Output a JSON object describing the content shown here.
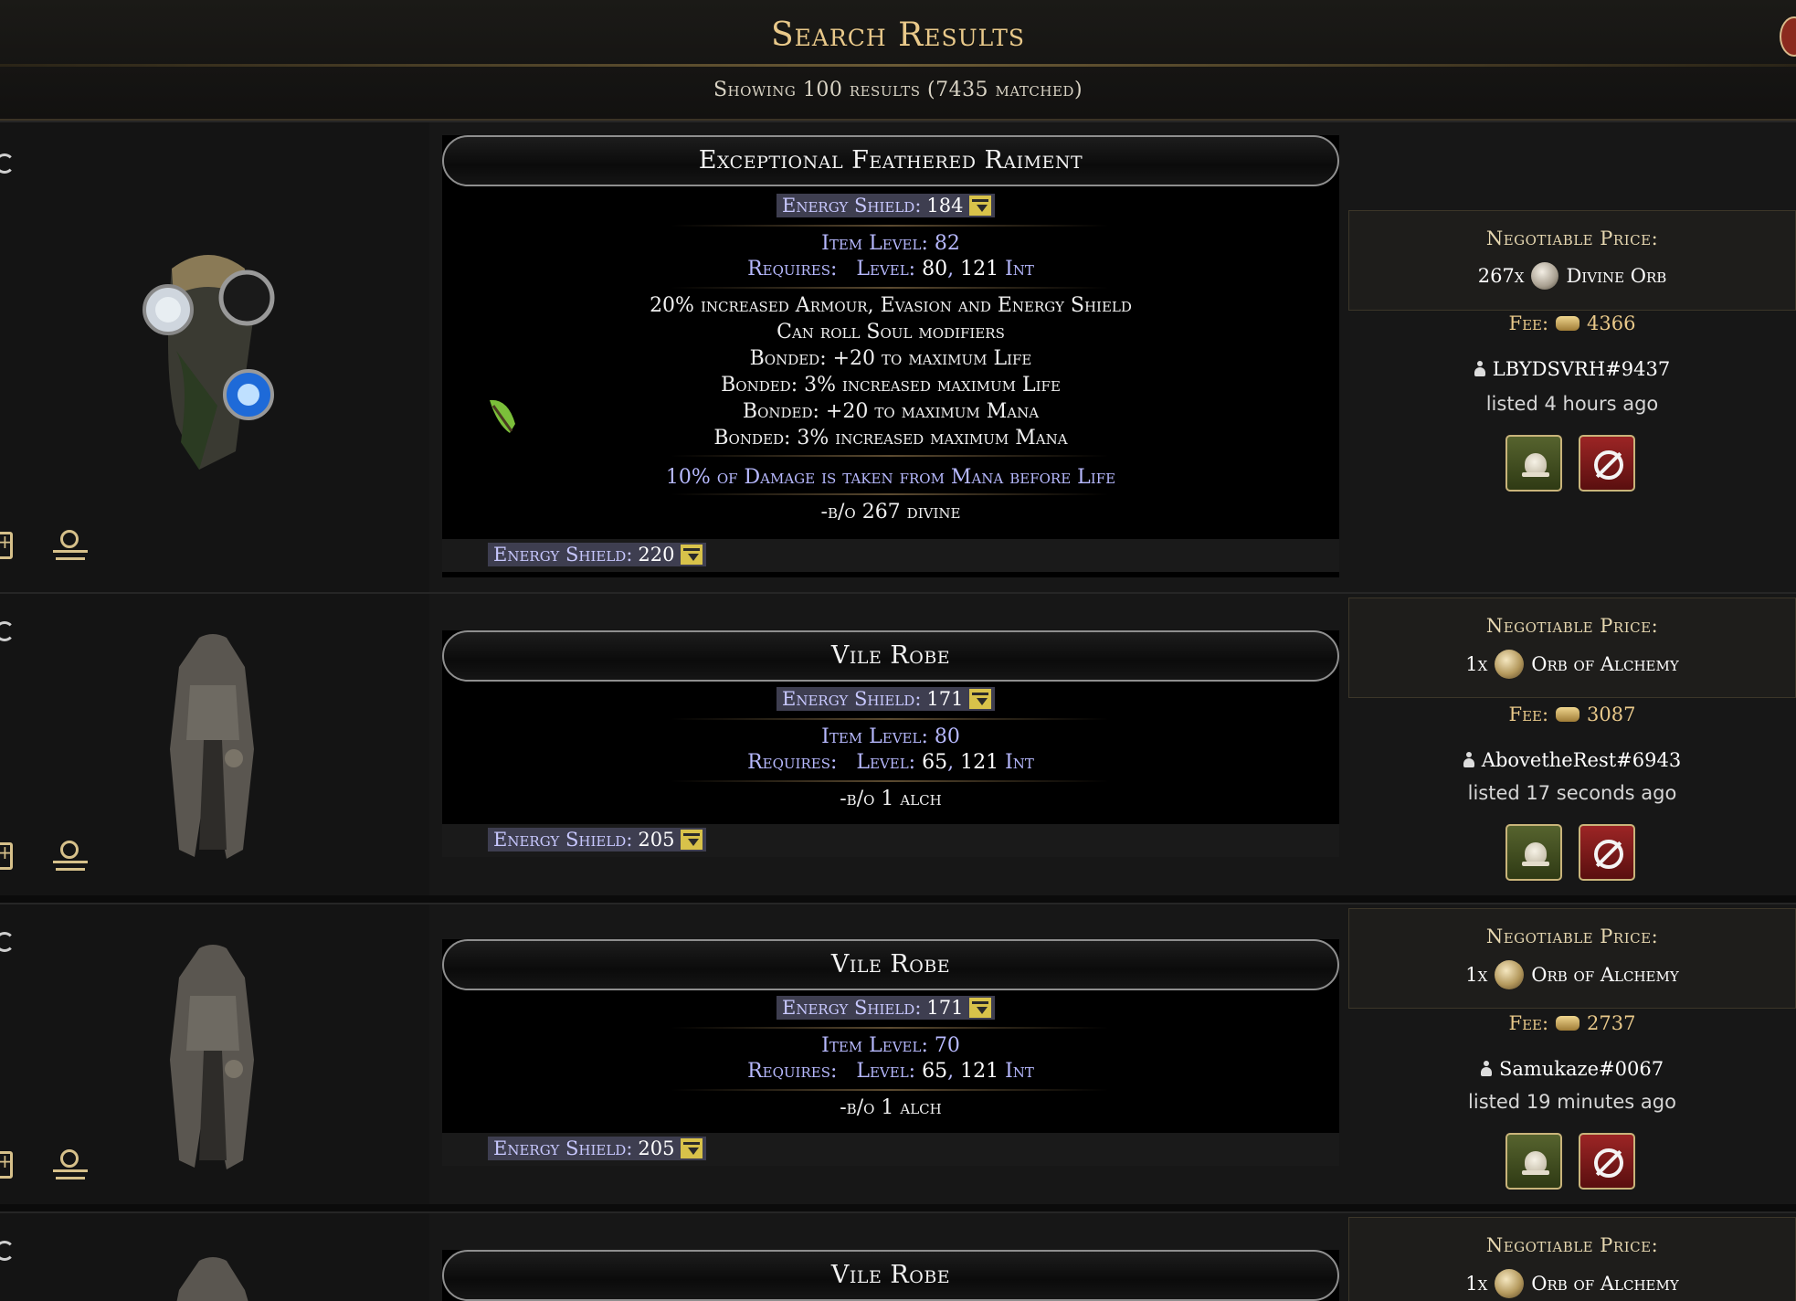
{
  "header": {
    "title": "Search Results",
    "subtitle": "Showing 100 results (7435 matched)"
  },
  "results": [
    {
      "name": "Exceptional Feathered Raiment",
      "energy_shield_label": "Energy Shield:",
      "energy_shield": "184",
      "item_level": "Item Level: 82",
      "requires_label": "Requires:",
      "requires_level_label": "Level:",
      "requires_level": "80",
      "requires_int": "121",
      "requires_int_label": "Int",
      "mods": [
        "20% increased Armour, Evasion and Energy Shield",
        "Can roll Soul modifiers",
        "Bonded: +20 to maximum Life",
        "Bonded: 3% increased maximum Life",
        "Bonded: +20 to maximum Mana",
        "Bonded: 3% increased maximum Mana"
      ],
      "implicit_extra": "10% of Damage is taken from Mana before Life",
      "note": "-b/o 267 divine",
      "footer_es_label": "Energy Shield:",
      "footer_es": "220",
      "price_label": "Negotiable Price:",
      "price_amount": "267x",
      "price_currency": "Divine Orb",
      "fee_label": "Fee:",
      "fee": "4366",
      "seller": "LBYDSVRH#9437",
      "listed": "listed 4 hours ago"
    },
    {
      "name": "Vile Robe",
      "energy_shield_label": "Energy Shield:",
      "energy_shield": "171",
      "item_level": "Item Level: 80",
      "requires_label": "Requires:",
      "requires_level_label": "Level:",
      "requires_level": "65",
      "requires_int": "121",
      "requires_int_label": "Int",
      "note": "-b/o 1 alch",
      "footer_es_label": "Energy Shield:",
      "footer_es": "205",
      "price_label": "Negotiable Price:",
      "price_amount": "1x",
      "price_currency": "Orb of Alchemy",
      "fee_label": "Fee:",
      "fee": "3087",
      "seller": "AbovetheRest#6943",
      "listed": "listed 17 seconds ago"
    },
    {
      "name": "Vile Robe",
      "energy_shield_label": "Energy Shield:",
      "energy_shield": "171",
      "item_level": "Item Level: 70",
      "requires_label": "Requires:",
      "requires_level_label": "Level:",
      "requires_level": "65",
      "requires_int": "121",
      "requires_int_label": "Int",
      "note": "-b/o 1 alch",
      "footer_es_label": "Energy Shield:",
      "footer_es": "205",
      "price_label": "Negotiable Price:",
      "price_amount": "1x",
      "price_currency": "Orb of Alchemy",
      "fee_label": "Fee:",
      "fee": "2737",
      "seller": "Samukaze#0067",
      "listed": "listed 19 minutes ago"
    },
    {
      "name": "Vile Robe",
      "price_label": "Negotiable Price:",
      "price_amount": "1x",
      "price_currency": "Orb of Alchemy"
    }
  ],
  "colors": {
    "title_gold": "#e9c98a",
    "magic_blue": "#b7b9ff",
    "buy_green": "#56632e",
    "block_red": "#9c2525"
  }
}
